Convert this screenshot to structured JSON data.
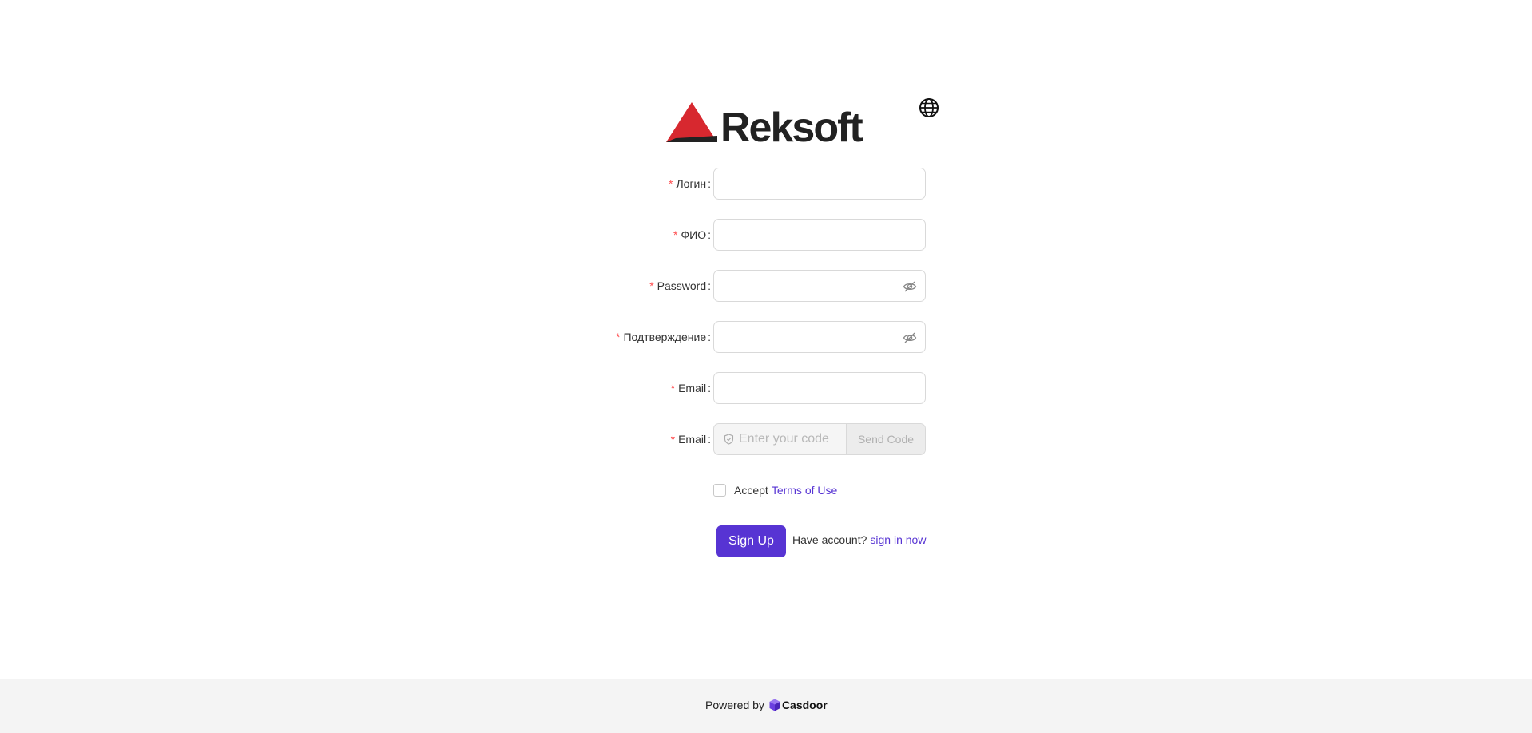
{
  "brand": {
    "logo_text": "Reksoft",
    "logo_color": "#d7282f"
  },
  "icons": {
    "language": "globe-icon",
    "password_toggle": "eye-slash-icon",
    "code": "shield-check-icon",
    "footer_brand": "casdoor-cube-icon"
  },
  "form": {
    "fields": [
      {
        "label": "Логин",
        "value": "",
        "required": true
      },
      {
        "label": "ФИО",
        "value": "",
        "required": true
      },
      {
        "label": "Password",
        "value": "",
        "required": true
      },
      {
        "label": "Подтверждение",
        "value": "",
        "required": true
      },
      {
        "label": "Email",
        "value": "",
        "required": true
      },
      {
        "label": "Email",
        "value": "",
        "required": true
      }
    ],
    "required_mark": "*",
    "colon": ":",
    "code_placeholder": "Enter your code",
    "send_code_label": "Send Code"
  },
  "terms": {
    "accept_label": "Accept",
    "link_label": "Terms of Use",
    "checked": false
  },
  "actions": {
    "signup_label": "Sign Up",
    "have_account_text": "Have account?",
    "signin_link_label": "sign in now"
  },
  "footer": {
    "powered_by": "Powered by",
    "brand_name": "Casdoor"
  },
  "colors": {
    "accent": "#5734d3",
    "required": "#ff4d4f",
    "footer_bg": "#f4f4f4"
  }
}
